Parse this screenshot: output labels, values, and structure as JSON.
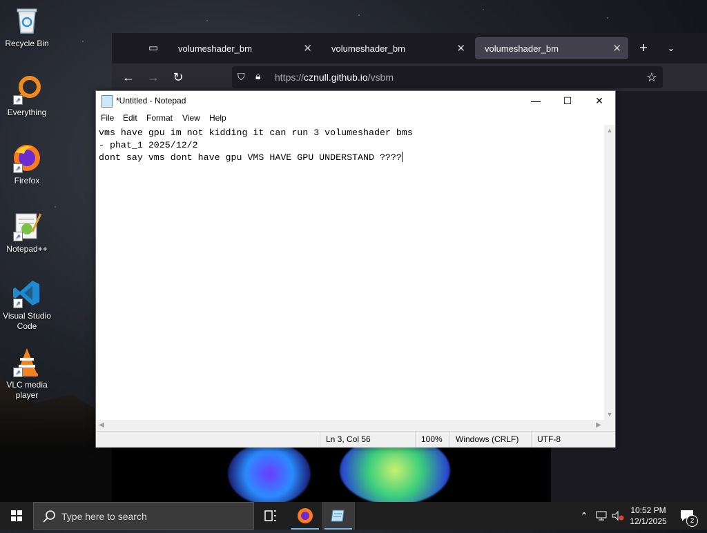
{
  "desktop": {
    "icons": [
      {
        "label": "Recycle Bin",
        "icon": "recycle-bin-icon"
      },
      {
        "label": "Everything",
        "icon": "everything-search-icon"
      },
      {
        "label": "Firefox",
        "icon": "firefox-icon"
      },
      {
        "label": "Notepad++",
        "icon": "notepad-plus-plus-icon"
      },
      {
        "label": "Visual Studio Code",
        "icon": "vscode-icon"
      },
      {
        "label": "VLC media player",
        "icon": "vlc-icon"
      }
    ]
  },
  "browser": {
    "tabs": [
      {
        "label": "volumeshader_bm",
        "active": false
      },
      {
        "label": "volumeshader_bm",
        "active": false
      },
      {
        "label": "volumeshader_bm",
        "active": true
      }
    ],
    "url_prefix": "https://",
    "url_host": "cznull.github.io",
    "url_path": "/vsbm"
  },
  "notepad": {
    "title": "*Untitled - Notepad",
    "menu": [
      "File",
      "Edit",
      "Format",
      "View",
      "Help"
    ],
    "lines": [
      "vms have gpu im not kidding it can run 3 volumeshader bms",
      "- phat_1 2025/12/2",
      "dont say vms dont have gpu VMS HAVE GPU UNDERSTAND ????"
    ],
    "status": {
      "position": "Ln 3, Col 56",
      "zoom": "100%",
      "line_ending": "Windows (CRLF)",
      "encoding": "UTF-8"
    }
  },
  "taskbar": {
    "search_placeholder": "Type here to search",
    "time": "10:52 PM",
    "date": "12/1/2025",
    "notification_count": "2"
  },
  "colors": {
    "taskbar_active_indicator": "#76b9ed",
    "browser_dark": "#1c1b22"
  }
}
